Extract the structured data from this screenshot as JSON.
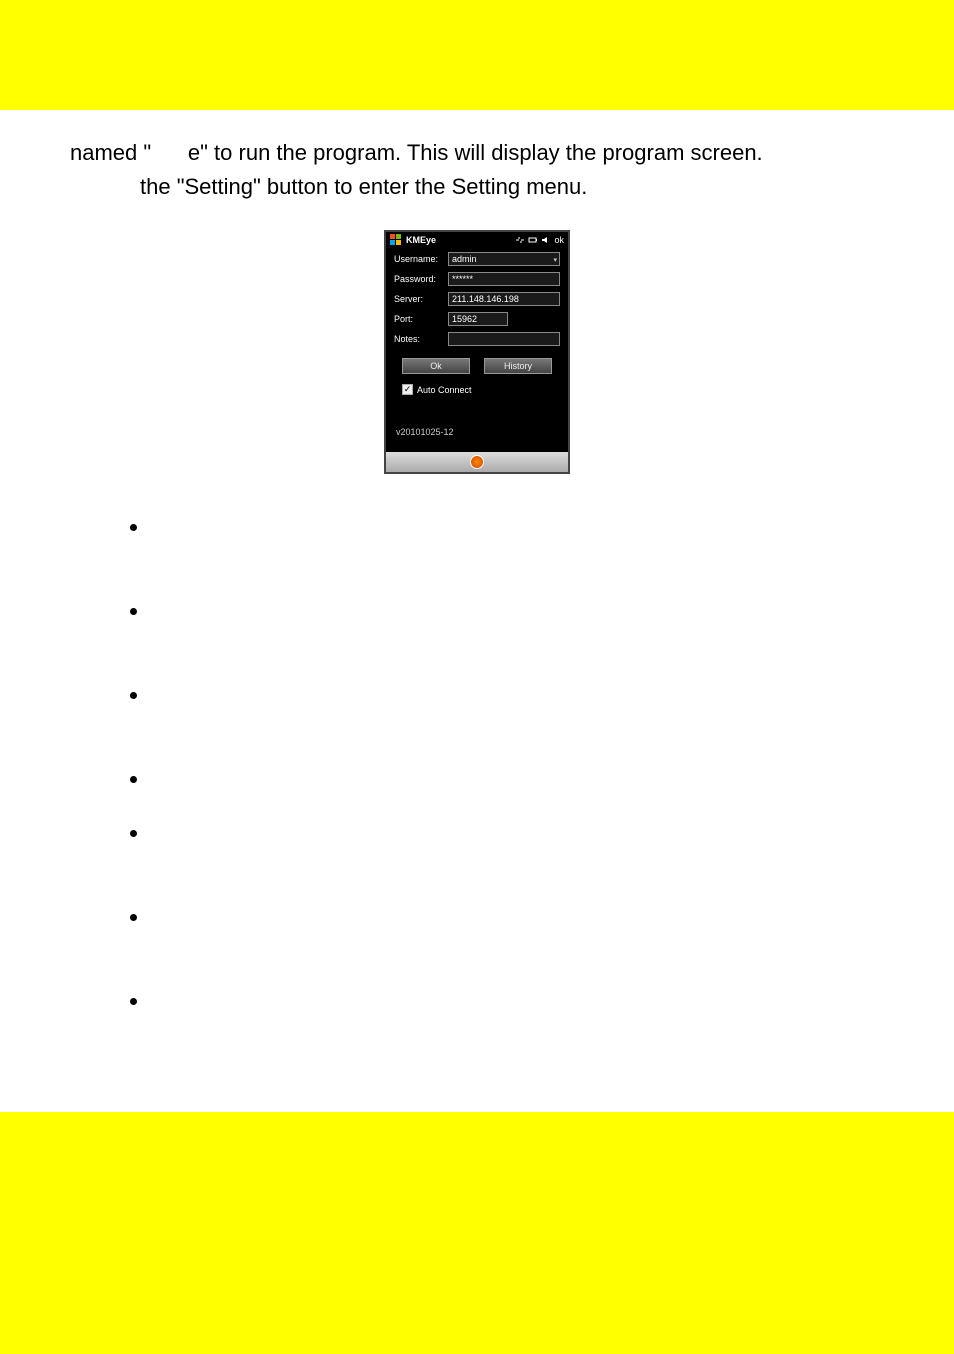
{
  "intro": {
    "line1_pre": "named \"",
    "line1_mid": "e\" to run the program. This will display the program screen.",
    "line2": "the \"Setting\" button to enter the Setting menu."
  },
  "phone": {
    "title": "KMEye",
    "ok_label": "ok",
    "fields": {
      "username_label": "Username:",
      "username_value": "admin",
      "password_label": "Password:",
      "password_value": "******",
      "server_label": "Server:",
      "server_value": "211.148.146.198",
      "port_label": "Port:",
      "port_value": "15962",
      "notes_label": "Notes:",
      "notes_value": ""
    },
    "buttons": {
      "ok": "Ok",
      "history": "History"
    },
    "auto_connect_label": "Auto Connect",
    "version": "v20101025-12"
  },
  "bullets": [
    "",
    "",
    "",
    "",
    "",
    "",
    ""
  ]
}
